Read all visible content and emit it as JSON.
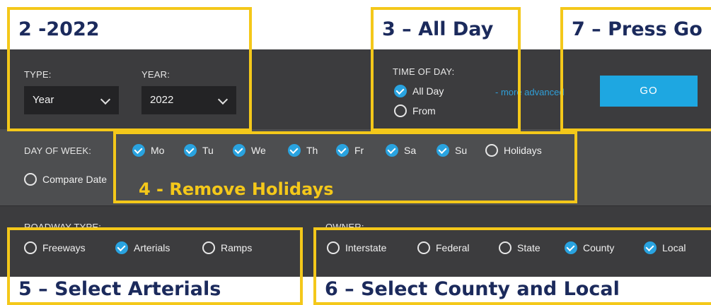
{
  "callouts": {
    "step2": "2 -2022",
    "step3": "3 – All Day",
    "step7": "7 – Press Go",
    "step4": "4 -  Remove Holidays",
    "step5": "5 – Select Arterials",
    "step6": "6 – Select County and Local"
  },
  "filters": {
    "type_label": "TYPE:",
    "type_value": "Year",
    "year_label": "YEAR:",
    "year_value": "2022",
    "time_of_day_label": "TIME OF DAY:",
    "time_options": [
      {
        "label": "All Day",
        "checked": true
      },
      {
        "label": "From",
        "checked": false
      }
    ],
    "more_link": "- more advanced",
    "go_label": "GO",
    "day_of_week_label": "DAY OF WEEK:",
    "days": [
      {
        "label": "Mo",
        "checked": true
      },
      {
        "label": "Tu",
        "checked": true
      },
      {
        "label": "We",
        "checked": true
      },
      {
        "label": "Th",
        "checked": true
      },
      {
        "label": "Fr",
        "checked": true
      },
      {
        "label": "Sa",
        "checked": true
      },
      {
        "label": "Su",
        "checked": true
      },
      {
        "label": "Holidays",
        "checked": false
      }
    ],
    "compare_date": {
      "label": "Compare Date",
      "checked": false
    },
    "roadway_type_label": "ROADWAY TYPE:",
    "roadway_types": [
      {
        "label": "Freeways",
        "checked": false
      },
      {
        "label": "Arterials",
        "checked": true
      },
      {
        "label": "Ramps",
        "checked": false
      }
    ],
    "owner_label": "OWNER:",
    "owners": [
      {
        "label": "Interstate",
        "checked": false
      },
      {
        "label": "Federal",
        "checked": false
      },
      {
        "label": "State",
        "checked": false
      },
      {
        "label": "County",
        "checked": true
      },
      {
        "label": "Local",
        "checked": true
      }
    ]
  },
  "colors": {
    "panel": "#3c3c3e",
    "accent": "#29a3e0",
    "callout_border": "#f4c81a",
    "callout_text": "#1b2a5c"
  }
}
